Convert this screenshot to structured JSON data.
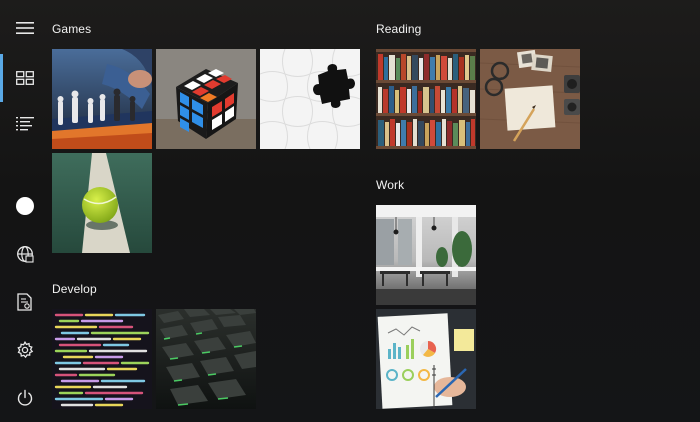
{
  "nav": {
    "items": [
      {
        "icon": "hamburger-icon"
      },
      {
        "icon": "tiles-icon",
        "active": true
      },
      {
        "icon": "list-icon"
      },
      {
        "icon": "user-avatar-icon"
      },
      {
        "icon": "globe-icon"
      },
      {
        "icon": "documents-icon"
      },
      {
        "icon": "gear-icon"
      },
      {
        "icon": "power-icon"
      }
    ],
    "accent": "#5aa9e6"
  },
  "groups": {
    "games": {
      "title": "Games",
      "tiles": [
        {
          "image": "chess-board"
        },
        {
          "image": "rubiks-cube"
        },
        {
          "image": "jigsaw-puzzle"
        },
        {
          "image": "tennis-ball"
        }
      ]
    },
    "develop": {
      "title": "Develop",
      "tiles": [
        {
          "image": "source-code-screen"
        },
        {
          "image": "backlit-keyboard"
        }
      ]
    },
    "reading": {
      "title": "Reading",
      "tiles": [
        {
          "image": "bookshelf"
        },
        {
          "image": "notebook-desk"
        }
      ]
    },
    "work": {
      "title": "Work",
      "tiles": [
        {
          "image": "open-office"
        },
        {
          "image": "charts-paperwork"
        }
      ]
    }
  }
}
